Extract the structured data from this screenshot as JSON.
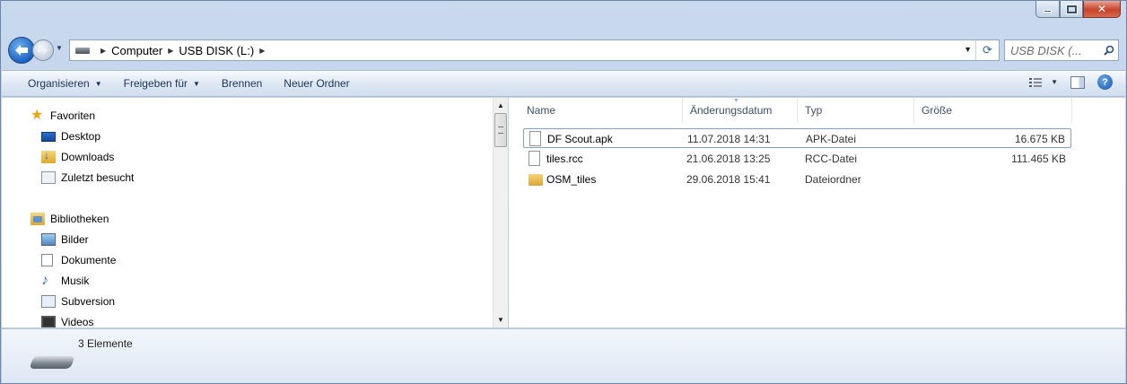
{
  "window": {
    "caption_buttons": [
      "minimize",
      "maximize",
      "close"
    ]
  },
  "navigation": {
    "breadcrumbs": [
      "Computer",
      "USB DISK (L:)"
    ],
    "search_placeholder": "USB DISK (..."
  },
  "toolbar": {
    "organize": "Organisieren",
    "share": "Freigeben für",
    "burn": "Brennen",
    "new_folder": "Neuer Ordner"
  },
  "nav_pane": {
    "favorites": {
      "label": "Favoriten",
      "items": [
        "Desktop",
        "Downloads",
        "Zuletzt besucht"
      ]
    },
    "libraries": {
      "label": "Bibliotheken",
      "items": [
        "Bilder",
        "Dokumente",
        "Musik",
        "Subversion",
        "Videos"
      ]
    }
  },
  "file_list": {
    "columns": [
      "Name",
      "Änderungsdatum",
      "Typ",
      "Größe"
    ],
    "rows": [
      {
        "name": "DF Scout.apk",
        "date": "11.07.2018 14:31",
        "type": "APK-Datei",
        "size": "16.675 KB",
        "icon": "file-icon"
      },
      {
        "name": "tiles.rcc",
        "date": "21.06.2018 13:25",
        "type": "RCC-Datei",
        "size": "111.465 KB",
        "icon": "file-icon"
      },
      {
        "name": "OSM_tiles",
        "date": "29.06.2018 15:41",
        "type": "Dateiordner",
        "size": "",
        "icon": "folder-icon"
      }
    ]
  },
  "status_bar": {
    "item_count": "3 Elemente"
  },
  "colors": {
    "chrome": "#c9d9ee",
    "toolbar_text": "#1b3359",
    "selection_border": "#7da2ce"
  }
}
